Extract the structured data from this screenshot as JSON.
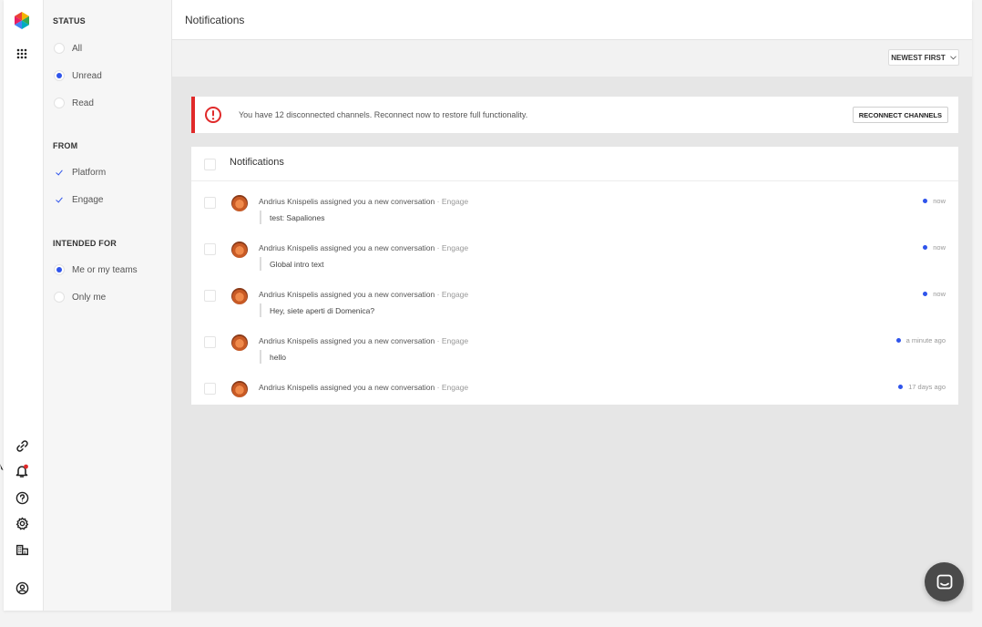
{
  "header": {
    "title": "Notifications"
  },
  "sort": {
    "label": "NEWEST FIRST"
  },
  "filters": {
    "status": {
      "heading": "STATUS",
      "options": [
        {
          "label": "All",
          "selected": false
        },
        {
          "label": "Unread",
          "selected": true
        },
        {
          "label": "Read",
          "selected": false
        }
      ]
    },
    "from": {
      "heading": "FROM",
      "options": [
        {
          "label": "Platform",
          "checked": true
        },
        {
          "label": "Engage",
          "checked": true
        }
      ]
    },
    "intended_for": {
      "heading": "INTENDED FOR",
      "options": [
        {
          "label": "Me or my teams",
          "selected": true
        },
        {
          "label": "Only me",
          "selected": false
        }
      ]
    }
  },
  "alert": {
    "message": "You have 12 disconnected channels. Reconnect now to restore full functionality.",
    "button": "RECONNECT CHANNELS",
    "color": "#e02a2a"
  },
  "list": {
    "heading": "Notifications",
    "items": [
      {
        "text": "Andrius Knispelis assigned you a new conversation",
        "source": "· Engage",
        "quote": "test: Sapaliones",
        "time": "now"
      },
      {
        "text": "Andrius Knispelis assigned you a new conversation",
        "source": "· Engage",
        "quote": "Global intro text",
        "time": "now"
      },
      {
        "text": "Andrius Knispelis assigned you a new conversation",
        "source": "· Engage",
        "quote": "Hey, siete aperti di Domenica?",
        "time": "now"
      },
      {
        "text": "Andrius Knispelis assigned you a new conversation",
        "source": "· Engage",
        "quote": "hello",
        "time": "a minute ago"
      },
      {
        "text": "Andrius Knispelis assigned you a new conversation",
        "source": "· Engage",
        "quote": "",
        "time": "17 days ago"
      }
    ]
  },
  "rail_icons": [
    "app-logo-icon",
    "apps-grid-icon",
    "link-icon",
    "bell-icon",
    "help-icon",
    "settings-icon",
    "building-icon",
    "user-account-icon"
  ],
  "colors": {
    "accent": "#2f54eb",
    "unread_dot": "#2f54eb",
    "badge": "#e02a2a"
  }
}
